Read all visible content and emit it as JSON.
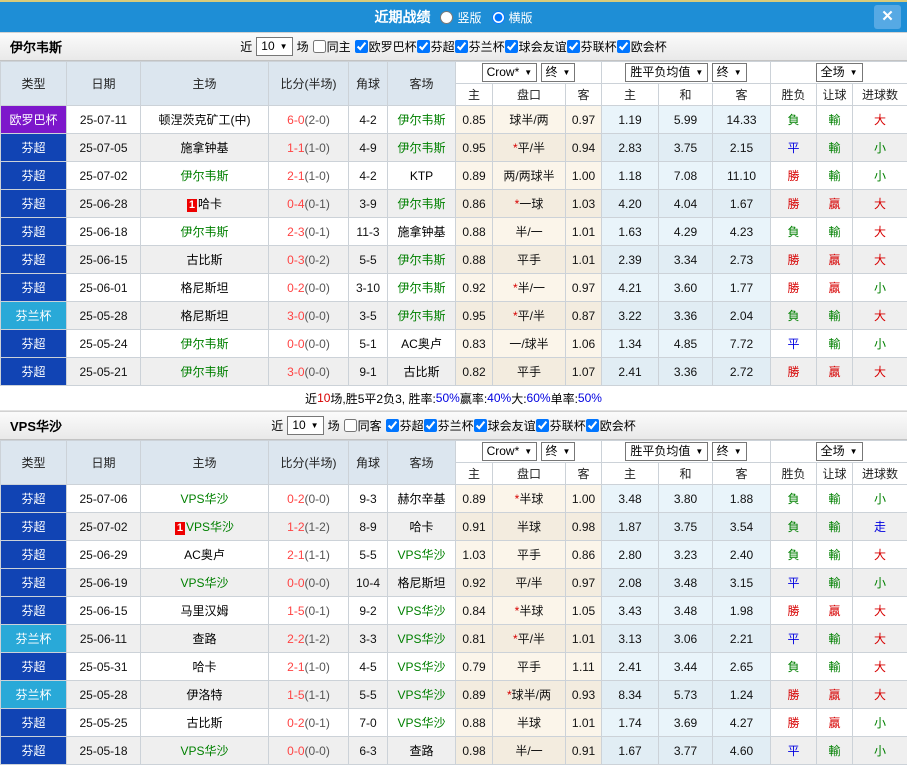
{
  "window": {
    "title": "近期战绩",
    "layout_options": [
      {
        "label": "竖版",
        "selected": false
      },
      {
        "label": "横版",
        "selected": true
      }
    ],
    "close_label": "✕"
  },
  "controls": {
    "recent": "近",
    "count": "10",
    "matches": "场"
  },
  "table_header": {
    "static_cols": [
      "类型",
      "日期",
      "主场",
      "比分(半场)",
      "角球",
      "客场"
    ],
    "asia_select": "Crow*",
    "asia_final": "终",
    "europe_select": "胜平负均值",
    "europe_final": "终",
    "scope_select": "全场",
    "sub_cols": [
      "主",
      "盘口",
      "客",
      "主",
      "和",
      "客",
      "胜负",
      "让球",
      "进球数"
    ]
  },
  "colors": {
    "header_blue": "#1e8ed6",
    "europa_purple": "#7d17cb",
    "fin_super_blue": "#1144b4",
    "fin_cup_cyan": "#29a9d8",
    "win_red": "#d70000",
    "lose_green": "#008000",
    "draw_blue": "#0000e0"
  },
  "sections": [
    {
      "team": "伊尔韦斯",
      "venue_label": "同主",
      "venue_checked": false,
      "leagues": [
        "欧罗巴杯",
        "芬超",
        "芬兰杯",
        "球会友谊",
        "芬联杯",
        "欧会杯"
      ],
      "rows": [
        {
          "lg": "欧罗巴杯",
          "lc": "europa",
          "date": "25-07-11",
          "home": "顿涅茨克矿工(中)",
          "hg": false,
          "bd": false,
          "score": "6-0",
          "half": "(2-0)",
          "cor": "4-2",
          "away": "伊尔韦斯",
          "ag": true,
          "ah": [
            "0.85",
            "球半/两",
            "0.97"
          ],
          "eu": [
            "1.19",
            "5.99",
            "14.33"
          ],
          "res": [
            "負",
            "輸",
            "大"
          ]
        },
        {
          "lg": "芬超",
          "lc": "super",
          "date": "25-07-05",
          "home": "施拿钟基",
          "hg": false,
          "bd": false,
          "score": "1-1",
          "half": "(1-0)",
          "cor": "4-9",
          "away": "伊尔韦斯",
          "ag": true,
          "ah": [
            "0.95",
            "*平/半",
            "0.94"
          ],
          "eu": [
            "2.83",
            "3.75",
            "2.15"
          ],
          "res": [
            "平",
            "輸",
            "小"
          ]
        },
        {
          "lg": "芬超",
          "lc": "super",
          "date": "25-07-02",
          "home": "伊尔韦斯",
          "hg": true,
          "bd": false,
          "score": "2-1",
          "half": "(1-0)",
          "cor": "4-2",
          "away": "KTP",
          "ag": false,
          "ah": [
            "0.89",
            "两/两球半",
            "1.00"
          ],
          "eu": [
            "1.18",
            "7.08",
            "11.10"
          ],
          "res": [
            "勝",
            "輸",
            "小"
          ]
        },
        {
          "lg": "芬超",
          "lc": "super",
          "date": "25-06-28",
          "home": "哈卡",
          "hg": false,
          "bd": true,
          "score": "0-4",
          "half": "(0-1)",
          "cor": "3-9",
          "away": "伊尔韦斯",
          "ag": true,
          "ah": [
            "0.86",
            "*一球",
            "1.03"
          ],
          "eu": [
            "4.20",
            "4.04",
            "1.67"
          ],
          "res": [
            "勝",
            "贏",
            "大"
          ]
        },
        {
          "lg": "芬超",
          "lc": "super",
          "date": "25-06-18",
          "home": "伊尔韦斯",
          "hg": true,
          "bd": false,
          "score": "2-3",
          "half": "(0-1)",
          "cor": "11-3",
          "away": "施拿钟基",
          "ag": false,
          "ah": [
            "0.88",
            "半/一",
            "1.01"
          ],
          "eu": [
            "1.63",
            "4.29",
            "4.23"
          ],
          "res": [
            "負",
            "輸",
            "大"
          ]
        },
        {
          "lg": "芬超",
          "lc": "super",
          "date": "25-06-15",
          "home": "古比斯",
          "hg": false,
          "bd": false,
          "score": "0-3",
          "half": "(0-2)",
          "cor": "5-5",
          "away": "伊尔韦斯",
          "ag": true,
          "ah": [
            "0.88",
            "平手",
            "1.01"
          ],
          "eu": [
            "2.39",
            "3.34",
            "2.73"
          ],
          "res": [
            "勝",
            "贏",
            "大"
          ]
        },
        {
          "lg": "芬超",
          "lc": "super",
          "date": "25-06-01",
          "home": "格尼斯坦",
          "hg": false,
          "bd": false,
          "score": "0-2",
          "half": "(0-0)",
          "cor": "3-10",
          "away": "伊尔韦斯",
          "ag": true,
          "ah": [
            "0.92",
            "*半/一",
            "0.97"
          ],
          "eu": [
            "4.21",
            "3.60",
            "1.77"
          ],
          "res": [
            "勝",
            "贏",
            "小"
          ]
        },
        {
          "lg": "芬兰杯",
          "lc": "cup",
          "date": "25-05-28",
          "home": "格尼斯坦",
          "hg": false,
          "bd": false,
          "score": "3-0",
          "half": "(0-0)",
          "cor": "3-5",
          "away": "伊尔韦斯",
          "ag": true,
          "ah": [
            "0.95",
            "*平/半",
            "0.87"
          ],
          "eu": [
            "3.22",
            "3.36",
            "2.04"
          ],
          "res": [
            "負",
            "輸",
            "大"
          ]
        },
        {
          "lg": "芬超",
          "lc": "super",
          "date": "25-05-24",
          "home": "伊尔韦斯",
          "hg": true,
          "bd": false,
          "score": "0-0",
          "half": "(0-0)",
          "cor": "5-1",
          "away": "AC奥卢",
          "ag": false,
          "ah": [
            "0.83",
            "一/球半",
            "1.06"
          ],
          "eu": [
            "1.34",
            "4.85",
            "7.72"
          ],
          "res": [
            "平",
            "輸",
            "小"
          ]
        },
        {
          "lg": "芬超",
          "lc": "super",
          "date": "25-05-21",
          "home": "伊尔韦斯",
          "hg": true,
          "bd": false,
          "score": "3-0",
          "half": "(0-0)",
          "cor": "9-1",
          "away": "古比斯",
          "ag": false,
          "ah": [
            "0.82",
            "平手",
            "1.07"
          ],
          "eu": [
            "2.41",
            "3.36",
            "2.72"
          ],
          "res": [
            "勝",
            "贏",
            "大"
          ]
        }
      ],
      "summary": [
        {
          "t": "近",
          "c": "k"
        },
        {
          "t": "10",
          "c": "r"
        },
        {
          "t": "场,胜5平2负3, 胜率:",
          "c": "k"
        },
        {
          "t": "50%",
          "c": "b"
        },
        {
          "t": " 赢率:",
          "c": "k"
        },
        {
          "t": "40%",
          "c": "b"
        },
        {
          "t": " 大:",
          "c": "k"
        },
        {
          "t": "60%",
          "c": "b"
        },
        {
          "t": " 单率:",
          "c": "k"
        },
        {
          "t": "50%",
          "c": "b"
        }
      ]
    },
    {
      "team": "VPS华沙",
      "venue_label": "同客",
      "venue_checked": false,
      "leagues": [
        "芬超",
        "芬兰杯",
        "球会友谊",
        "芬联杯",
        "欧会杯"
      ],
      "rows": [
        {
          "lg": "芬超",
          "lc": "super",
          "date": "25-07-06",
          "home": "VPS华沙",
          "hg": true,
          "bd": false,
          "score": "0-2",
          "half": "(0-0)",
          "cor": "9-3",
          "away": "赫尔辛基",
          "ag": false,
          "ah": [
            "0.89",
            "*半球",
            "1.00"
          ],
          "eu": [
            "3.48",
            "3.80",
            "1.88"
          ],
          "res": [
            "負",
            "輸",
            "小"
          ]
        },
        {
          "lg": "芬超",
          "lc": "super",
          "date": "25-07-02",
          "home": "VPS华沙",
          "hg": true,
          "bd": true,
          "score": "1-2",
          "half": "(1-2)",
          "cor": "8-9",
          "away": "哈卡",
          "ag": false,
          "ah": [
            "0.91",
            "半球",
            "0.98"
          ],
          "eu": [
            "1.87",
            "3.75",
            "3.54"
          ],
          "res": [
            "負",
            "輸",
            "走"
          ]
        },
        {
          "lg": "芬超",
          "lc": "super",
          "date": "25-06-29",
          "home": "AC奥卢",
          "hg": false,
          "bd": false,
          "score": "2-1",
          "half": "(1-1)",
          "cor": "5-5",
          "away": "VPS华沙",
          "ag": true,
          "ah": [
            "1.03",
            "平手",
            "0.86"
          ],
          "eu": [
            "2.80",
            "3.23",
            "2.40"
          ],
          "res": [
            "負",
            "輸",
            "大"
          ]
        },
        {
          "lg": "芬超",
          "lc": "super",
          "date": "25-06-19",
          "home": "VPS华沙",
          "hg": true,
          "bd": false,
          "score": "0-0",
          "half": "(0-0)",
          "cor": "10-4",
          "away": "格尼斯坦",
          "ag": false,
          "ah": [
            "0.92",
            "平/半",
            "0.97"
          ],
          "eu": [
            "2.08",
            "3.48",
            "3.15"
          ],
          "res": [
            "平",
            "輸",
            "小"
          ]
        },
        {
          "lg": "芬超",
          "lc": "super",
          "date": "25-06-15",
          "home": "马里汉姆",
          "hg": false,
          "bd": false,
          "score": "1-5",
          "half": "(0-1)",
          "cor": "9-2",
          "away": "VPS华沙",
          "ag": true,
          "ah": [
            "0.84",
            "*半球",
            "1.05"
          ],
          "eu": [
            "3.43",
            "3.48",
            "1.98"
          ],
          "res": [
            "勝",
            "贏",
            "大"
          ]
        },
        {
          "lg": "芬兰杯",
          "lc": "cup",
          "date": "25-06-11",
          "home": "查路",
          "hg": false,
          "bd": false,
          "score": "2-2",
          "half": "(1-2)",
          "cor": "3-3",
          "away": "VPS华沙",
          "ag": true,
          "ah": [
            "0.81",
            "*平/半",
            "1.01"
          ],
          "eu": [
            "3.13",
            "3.06",
            "2.21"
          ],
          "res": [
            "平",
            "輸",
            "大"
          ]
        },
        {
          "lg": "芬超",
          "lc": "super",
          "date": "25-05-31",
          "home": "哈卡",
          "hg": false,
          "bd": false,
          "score": "2-1",
          "half": "(1-0)",
          "cor": "4-5",
          "away": "VPS华沙",
          "ag": true,
          "ah": [
            "0.79",
            "平手",
            "1.11"
          ],
          "eu": [
            "2.41",
            "3.44",
            "2.65"
          ],
          "res": [
            "負",
            "輸",
            "大"
          ]
        },
        {
          "lg": "芬兰杯",
          "lc": "cup",
          "date": "25-05-28",
          "home": "伊洛特",
          "hg": false,
          "bd": false,
          "score": "1-5",
          "half": "(1-1)",
          "cor": "5-5",
          "away": "VPS华沙",
          "ag": true,
          "ah": [
            "0.89",
            "*球半/两",
            "0.93"
          ],
          "eu": [
            "8.34",
            "5.73",
            "1.24"
          ],
          "res": [
            "勝",
            "贏",
            "大"
          ]
        },
        {
          "lg": "芬超",
          "lc": "super",
          "date": "25-05-25",
          "home": "古比斯",
          "hg": false,
          "bd": false,
          "score": "0-2",
          "half": "(0-1)",
          "cor": "7-0",
          "away": "VPS华沙",
          "ag": true,
          "ah": [
            "0.88",
            "半球",
            "1.01"
          ],
          "eu": [
            "1.74",
            "3.69",
            "4.27"
          ],
          "res": [
            "勝",
            "贏",
            "小"
          ]
        },
        {
          "lg": "芬超",
          "lc": "super",
          "date": "25-05-18",
          "home": "VPS华沙",
          "hg": true,
          "bd": false,
          "score": "0-0",
          "half": "(0-0)",
          "cor": "6-3",
          "away": "查路",
          "ag": false,
          "ah": [
            "0.98",
            "半/一",
            "0.91"
          ],
          "eu": [
            "1.67",
            "3.77",
            "4.60"
          ],
          "res": [
            "平",
            "輸",
            "小"
          ]
        }
      ],
      "summary": []
    }
  ]
}
